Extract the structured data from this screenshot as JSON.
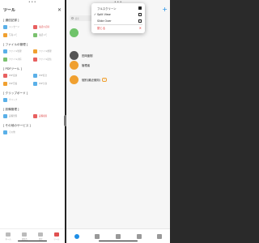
{
  "status": {
    "dots": "•••"
  },
  "left": {
    "title": "ツール",
    "close_icon": "✕",
    "sections": [
      {
        "title": "[ 通信記録 ]",
        "rows": [
          [
            {
              "icon_color": "#5ab0e8",
              "label": "メッセージ",
              "highlight": false
            },
            {
              "icon_color": "#e86060",
              "label": "電話の記録",
              "highlight": true
            }
          ],
          [
            {
              "icon_color": "#f0a030",
              "label": "写真メモ",
              "highlight": false
            },
            {
              "icon_color": "#7ac16e",
              "label": "電話メモ",
              "highlight": false
            }
          ]
        ]
      },
      {
        "title": "[ ファイルの管理 ]",
        "rows": [
          [
            {
              "icon_color": "#5ab0e8",
              "label": "ファイル管理",
              "highlight": false
            },
            {
              "icon_color": "#f0a030",
              "label": "ファイル整理",
              "highlight": false
            }
          ],
          [
            {
              "icon_color": "#7ac16e",
              "label": "ファイル共有",
              "highlight": false
            },
            {
              "icon_color": "#e86060",
              "label": "ファイル送信",
              "highlight": false
            }
          ]
        ]
      },
      {
        "title": "[ PDFツール ]",
        "rows": [
          [
            {
              "icon_color": "#e86060",
              "label": "PDF変換",
              "highlight": false
            },
            {
              "icon_color": "#5ab0e8",
              "label": "PDF結合",
              "highlight": false
            }
          ],
          [
            {
              "icon_color": "#f0a030",
              "label": "PDF圧縮",
              "highlight": false
            },
            {
              "icon_color": "#5ab0e8",
              "label": "PDF分割",
              "highlight": false
            }
          ]
        ]
      },
      {
        "title": "[ クリップボード ]",
        "rows": [
          [
            {
              "icon_color": "#5ab0e8",
              "label": "クリップ",
              "highlight": false
            }
          ]
        ]
      },
      {
        "title": "[ 設備管理 ]",
        "rows": [
          [
            {
              "icon_color": "#5ab0e8",
              "label": "設備管理",
              "highlight": false
            },
            {
              "icon_color": "#e86060",
              "label": "設備検索",
              "highlight": true
            }
          ]
        ]
      },
      {
        "title": "[ その他のサービス ]",
        "rows": [
          [
            {
              "icon_color": "#5ab0e8",
              "label": "その他",
              "highlight": false
            }
          ]
        ]
      }
    ],
    "nav": [
      {
        "label": "ホーム",
        "active": false
      },
      {
        "label": "連絡先",
        "active": false
      },
      {
        "label": "発見",
        "active": false
      },
      {
        "label": "ツール",
        "active": true
      }
    ]
  },
  "right": {
    "plus": "+",
    "search_placeholder": "検索",
    "contacts": [
      {
        "name": "",
        "avatar_color": "#6fc36a",
        "tag": ""
      },
      {
        "name": "田岡亜樹",
        "avatar_color": "#555555",
        "tag": ""
      },
      {
        "name": "管理者",
        "avatar_color": "#f0a030",
        "tag": ""
      },
      {
        "name": "個別(最近使用)",
        "avatar_color": "#f0a030",
        "tag": "⚠"
      }
    ],
    "popover": [
      {
        "label": "フルスクリーン",
        "checked": false,
        "icon": "full",
        "danger": false
      },
      {
        "label": "Split View",
        "checked": true,
        "icon": "split",
        "danger": false
      },
      {
        "label": "Slide Over",
        "checked": false,
        "icon": "slide",
        "danger": false
      },
      {
        "label": "閉じる",
        "checked": false,
        "icon": "close",
        "danger": true
      }
    ]
  }
}
